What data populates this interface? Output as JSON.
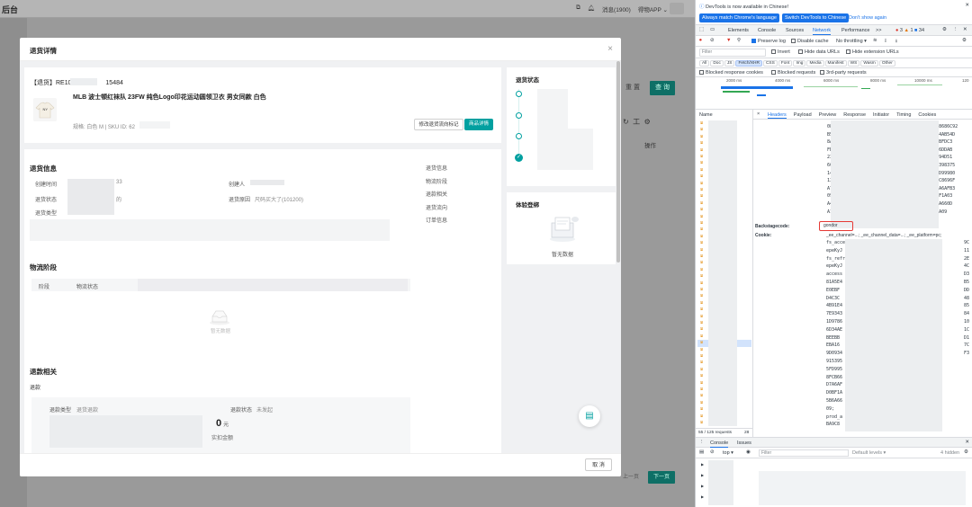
{
  "app": {
    "brand": "后台",
    "header_right": {
      "messages": "消息(1900)",
      "app_link": "得物APP"
    },
    "background": {
      "reset_label": "重 置",
      "search_label": "查 询",
      "ops_header": "操作",
      "pager_prev": "上一页",
      "pager_next": "下一页",
      "pager_hint": "第1页"
    }
  },
  "modal": {
    "title": "退货详情",
    "close_glyph": "×",
    "order": {
      "id_prefix": "【退货】RE101",
      "id_suffix": "15484",
      "product_title": "MLB 波士顿红袜队 23FW 纯色Logo印花运动圆领卫衣 男女同款 白色",
      "spec": "规格: 白色 M",
      "sku": "SKU ID: 62",
      "btn_modify": "修改退货流向标记",
      "btn_detail": "商品详情"
    },
    "status_panel": {
      "title": "退货状态"
    },
    "return_info": {
      "title": "退货信息",
      "created_time_label": "创建时间",
      "created_time_tail": "33",
      "creator_label": "创建人",
      "return_status_label": "退货状态",
      "return_status_tail": "的",
      "reason_label": "退货原因",
      "reason_value": "尺码买大了(101200)",
      "type_label": "退货类型"
    },
    "anchor_nav": [
      "退货信息",
      "物流阶段",
      "退款相关",
      "退货流向",
      "订单信息"
    ],
    "experience": {
      "title": "体验登绑",
      "empty": "暂无数据"
    },
    "logistics": {
      "title": "物流阶段",
      "col_stage": "阶段",
      "col_status": "物流状态",
      "empty": "暂无数据"
    },
    "refund": {
      "title": "退款相关",
      "subtitle": "退款",
      "type_label": "退款类型",
      "type_value": "退货退款",
      "status_label": "退款状态",
      "status_value": "未发起",
      "amount": "0",
      "amount_unit": "元",
      "amount_label": "实扣金额"
    },
    "footer": {
      "cancel": "取 消"
    }
  },
  "devtools": {
    "banner": "DevTools is now available in Chinese!",
    "btn_match": "Always match Chrome's language",
    "btn_switch": "Switch DevTools to Chinese",
    "btn_dont_show": "Don't show again",
    "tabs": [
      "Elements",
      "Console",
      "Sources",
      "Network",
      "Performance",
      ">>"
    ],
    "badges": {
      "errors": "3",
      "warnings": "1",
      "info": "34"
    },
    "toolbar": {
      "preserve_log": "Preserve log",
      "disable_cache": "Disable cache",
      "throttling": "No throttling"
    },
    "filter_placeholder": "Filter",
    "filter_opts": {
      "invert": "Invert",
      "hide_data": "Hide data URLs",
      "hide_ext": "Hide extension URLs"
    },
    "type_pills": [
      "All",
      "Doc",
      "JS",
      "Fetch/XHR",
      "CSS",
      "Font",
      "Img",
      "Media",
      "Manifest",
      "WS",
      "Wasm",
      "Other"
    ],
    "block_opts": {
      "blocked_cookies": "Blocked response cookies",
      "blocked_requests": "Blocked requests",
      "third_party": "3rd-party requests"
    },
    "timeline_ticks": [
      "2000 ms",
      "4000 ms",
      "6000 ms",
      "8000 ms",
      "10000 ms",
      "120"
    ],
    "detail_tabs": [
      "Headers",
      "Payload",
      "Preview",
      "Response",
      "Initiator",
      "Timing",
      "Cookies"
    ],
    "name_col": "Name",
    "close_glyph": "×",
    "hex_lines": [
      "082EDFA214D0895",
      "B5C8FB9A2571633",
      "8AFD7240920E66F",
      "FB02668A5A2E924",
      "2305B9C296A87A9",
      "6CC1E41A704BD1",
      "146514F44048E19",
      "134998FFSCEAC6A",
      "A704C326EBD6EEA",
      "0902703997623AD",
      "A4CD3C1A0EDEF",
      "A1E9E0DAF43757"
    ],
    "hex_right": [
      "8127411D978686C92",
      "A9E69BB5C04AB54D",
      "8B6945BEE9BFDC3",
      "C098EBEBA16DDAB",
      "5D3958990994D51",
      "DA39964915398375",
      "2A2B0D365FD99980",
      "124912EE8FC8696F",
      "0269D1BCD7A6AFB3",
      "B13492D00BF1A03",
      "6EE60865B5A660D",
      "7C1F319EFAA09"
    ],
    "backstage_label": "Backstagecode:",
    "backstage_value": "gondor",
    "cookie_label": "Cookie:",
    "cookie_value": "_ee_channel=...; _ee_channel_data=...; _ee_platform=pc;",
    "cookie_lines": [
      "fs_acce",
      "epeKyJ",
      "fs_refre",
      "epeKyJ",
      "access",
      "81A5E4",
      "E0EBF",
      "D4C3C",
      "4B91E4",
      "7E9343",
      "1D9786",
      "6D34AE",
      "BEEBB",
      "EBA16",
      "9D0934",
      "915395",
      "5FD995",
      "8FCB66",
      "D7A6AF",
      "D0BF1A",
      "5B6A66",
      "09;",
      "prod_a",
      "BA9C8"
    ],
    "cookie_right": [
      "9C",
      "11",
      "2E",
      "4C",
      "D3",
      "B5",
      "DD",
      "48",
      "85",
      "84",
      "10",
      "1C",
      "D1",
      "7C",
      "F3"
    ],
    "requests_status": "55 / 125 requests",
    "requests_tail": "28",
    "console_tabs": [
      "Console",
      "Issues"
    ],
    "console_top": "top",
    "console_filter": "Filter",
    "console_levels": "Default levels",
    "console_hidden": "4 hidden"
  }
}
